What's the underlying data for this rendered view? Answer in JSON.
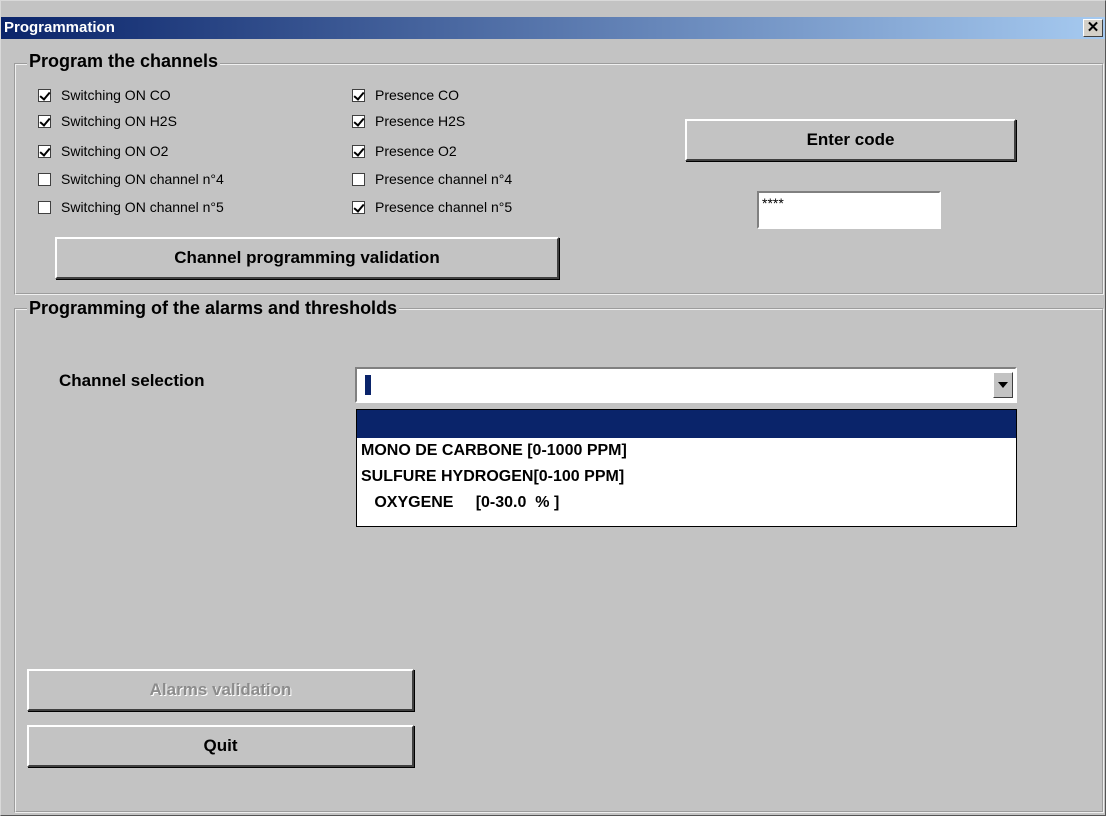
{
  "window": {
    "title": "Programmation",
    "close_glyph": "✕"
  },
  "channels_group": {
    "legend": "Program the channels",
    "switching": [
      {
        "label": "Switching ON CO",
        "checked": true
      },
      {
        "label": "Switching ON H2S",
        "checked": true
      },
      {
        "label": "Switching ON O2",
        "checked": true
      },
      {
        "label": "Switching ON channel n°4",
        "checked": false
      },
      {
        "label": "Switching ON channel n°5",
        "checked": false
      }
    ],
    "presence": [
      {
        "label": "Presence CO",
        "checked": true
      },
      {
        "label": "Presence H2S",
        "checked": true
      },
      {
        "label": "Presence O2",
        "checked": true
      },
      {
        "label": "Presence channel n°4",
        "checked": false
      },
      {
        "label": "Presence channel n°5",
        "checked": true
      }
    ],
    "validate_label": "Channel programming validation",
    "enter_code_label": "Enter code",
    "code_value": "****"
  },
  "alarms_group": {
    "legend": "Programming of the alarms and thresholds",
    "selection_label": "Channel selection",
    "combo_value": "",
    "options": [
      "",
      "MONO DE CARBONE [0-1000 PPM]",
      "SULFURE HYDROGEN[0-100 PPM]",
      "   OXYGENE     [0-30.0  % ]"
    ],
    "selected_index": 0,
    "alarms_validation_label": "Alarms validation",
    "quit_label": "Quit"
  }
}
